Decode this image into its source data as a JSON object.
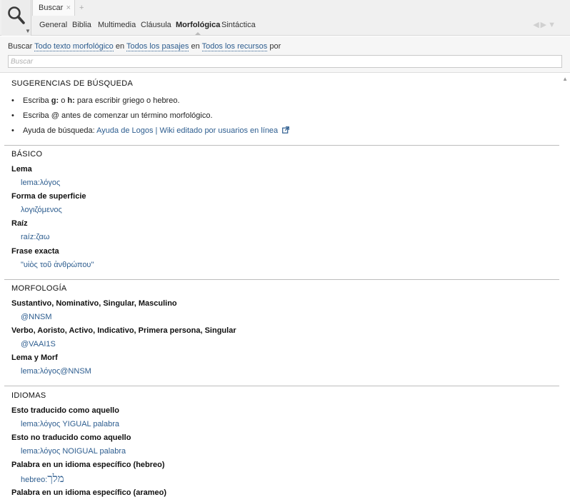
{
  "window": {
    "tab_label": "Buscar",
    "tab_close": "×",
    "tab_add": "+",
    "subtabs": [
      "General",
      "Biblia",
      "Multimedia",
      "Cláusula",
      "Morfológica",
      "Sintáctica"
    ],
    "active_subtab": "Morfológica",
    "nav_arrows": "◀▶▼"
  },
  "search": {
    "prefix": "Buscar",
    "scope_text": "Todo texto morfológico",
    "in1": "en",
    "passages": "Todos los pasajes",
    "in2": "en",
    "resources": "Todos los recursos",
    "suffix": "por",
    "placeholder": "Buscar",
    "value": ""
  },
  "tips": {
    "title": "SUGERENCIAS DE BÚSQUEDA",
    "tip1_pre": "Escriba ",
    "tip1_g": "g:",
    "tip1_mid": " o ",
    "tip1_h": "h:",
    "tip1_post": " para escribir griego o hebreo.",
    "tip2": "Escriba @ antes de comenzar un término morfológico.",
    "tip3_pre": "Ayuda de búsqueda: ",
    "tip3_link1": "Ayuda de Logos",
    "tip3_sep": " | ",
    "tip3_link2": "Wiki editado por usuarios en línea"
  },
  "basico": {
    "title": "BÁSICO",
    "items": [
      {
        "label": "Lema",
        "example": "lema:λόγος"
      },
      {
        "label": "Forma de superficie",
        "example": "λογιζόμενος"
      },
      {
        "label": "Raíz",
        "example": "raíz:ζαω"
      },
      {
        "label": "Frase exacta",
        "example": "\"υἱὸς τοῦ ἀνθρώπου\""
      }
    ]
  },
  "morfologia": {
    "title": "MORFOLOGÍA",
    "items": [
      {
        "label": "Sustantivo, Nominativo, Singular, Masculino",
        "example": "@NNSM"
      },
      {
        "label": "Verbo, Aoristo, Activo, Indicativo, Primera persona, Singular",
        "example": "@VAAI1S"
      },
      {
        "label": "Lema y Morf",
        "example": "lema:λόγος@NNSM"
      }
    ]
  },
  "idiomas": {
    "title": "IDIOMAS",
    "items": [
      {
        "label": "Esto traducido como aquello",
        "example": "lema:λόγος YIGUAL palabra"
      },
      {
        "label": "Esto no traducido como aquello",
        "example": "lema:λόγος NOIGUAL palabra"
      },
      {
        "label": "Palabra en un idioma específico (hebreo)",
        "example_prefix": "hebreo:",
        "example_hebrew": "מלך"
      },
      {
        "label": "Palabra en un idioma específico (arameo)",
        "example": ""
      }
    ]
  },
  "colors": {
    "link": "#2d5d8f",
    "divider": "#bdbdbd",
    "toolbar_bg": "#f0f0f0"
  },
  "icons": [
    "search-icon",
    "chevron-down-icon",
    "close-icon",
    "plus-icon",
    "external-link-icon",
    "scroll-up-icon"
  ]
}
